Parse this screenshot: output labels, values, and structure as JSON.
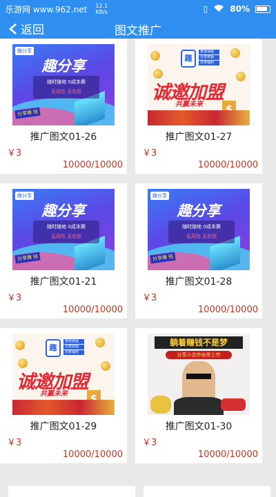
{
  "status_bar": {
    "left_text": "乐游网 www.962.net",
    "speed_value": "12.1",
    "speed_unit": "KB/s",
    "battery": "80%"
  },
  "nav": {
    "back_label": "返回",
    "title": "图文推广"
  },
  "thumbnails": {
    "qfx": {
      "logo": "趣分享",
      "big": "趣分享",
      "line1": "随时随地 0成本赛",
      "line2": "无风险 无负担",
      "tag": "分享赚 钱"
    },
    "cxjm": {
      "badge": "趣",
      "side": [
        "普票保留",
        "分享奖励",
        "日常福利"
      ],
      "big": "诚邀加盟",
      "sub": "共赢未来",
      "dollar": "$"
    },
    "zqmq": {
      "banner": "躺着赚钱不是梦",
      "sub": "分享小合作伙伴上市"
    }
  },
  "cards": [
    {
      "name": "推广图文01-26",
      "price": "￥3",
      "stock": "10000/10000",
      "thumb": "qfx"
    },
    {
      "name": "推广图文01-27",
      "price": "￥3",
      "stock": "10000/10000",
      "thumb": "cxjm"
    },
    {
      "name": "推广图文01-21",
      "price": "￥3",
      "stock": "10000/10000",
      "thumb": "qfx"
    },
    {
      "name": "推广图文01-28",
      "price": "￥3",
      "stock": "10000/10000",
      "thumb": "qfx"
    },
    {
      "name": "推广图文01-29",
      "price": "￥3",
      "stock": "10000/10000",
      "thumb": "cxjm"
    },
    {
      "name": "推广图文01-30",
      "price": "￥3",
      "stock": "10000/10000",
      "thumb": "zqmq"
    }
  ]
}
